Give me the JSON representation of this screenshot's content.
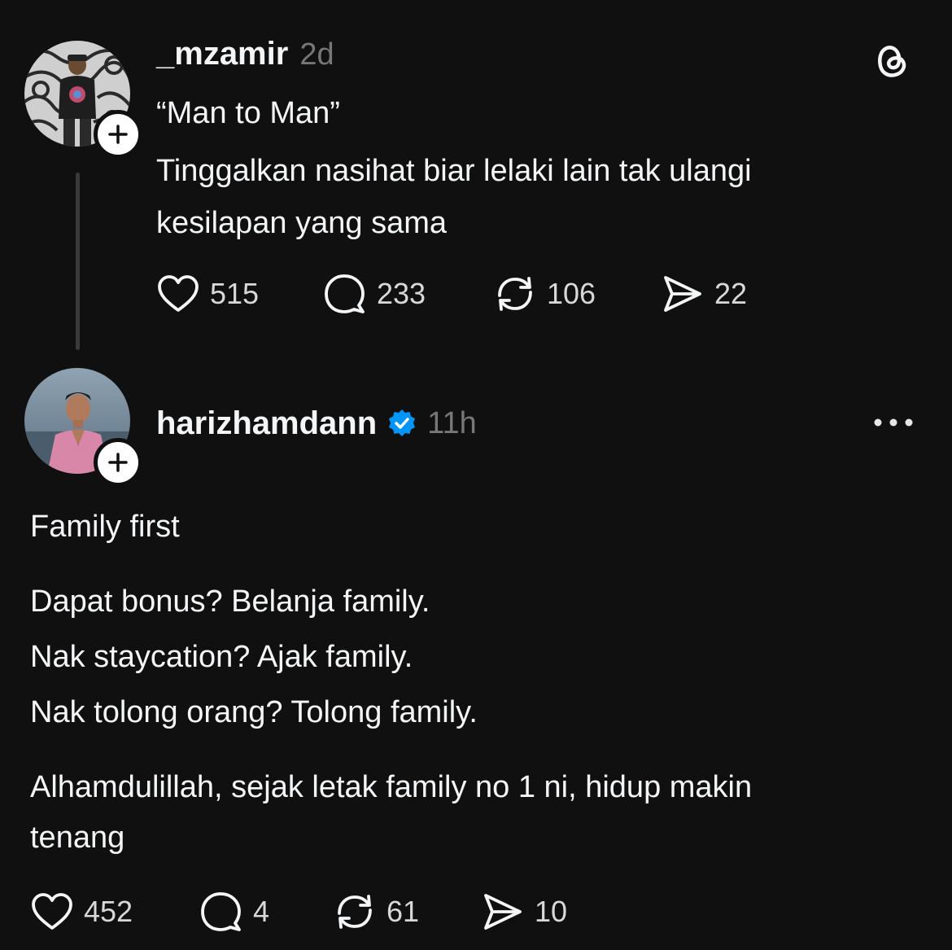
{
  "post1": {
    "username": "_mzamir",
    "time": "2d",
    "text_lines": [
      "“Man to Man”",
      "Tinggalkan nasihat biar lelaki lain tak ulangi",
      "kesilapan yang sama"
    ],
    "likes": "515",
    "replies": "233",
    "reposts": "106",
    "shares": "22"
  },
  "post2": {
    "username": "harizhamdann",
    "verified": true,
    "time": "11h",
    "paragraph1": [
      "Family first"
    ],
    "paragraph2": [
      "Dapat bonus? Belanja family.",
      "Nak staycation? Ajak family.",
      "Nak tolong orang? Tolong family."
    ],
    "paragraph3": [
      "Alhamdulillah, sejak letak family no 1 ni, hidup makin",
      "tenang"
    ],
    "likes": "452",
    "replies": "4",
    "reposts": "61",
    "shares": "10"
  },
  "icons": {
    "app_logo": "threads-logo-icon",
    "like": "heart-icon",
    "reply": "speech-bubble-icon",
    "repost": "repost-arrows-icon",
    "share": "paper-plane-icon",
    "more": "more-dots-icon",
    "follow": "plus-icon",
    "verified": "verified-badge-icon"
  },
  "colors": {
    "background": "#101010",
    "text": "#f3f5f7",
    "muted": "#777777",
    "verified": "#0095f6"
  }
}
